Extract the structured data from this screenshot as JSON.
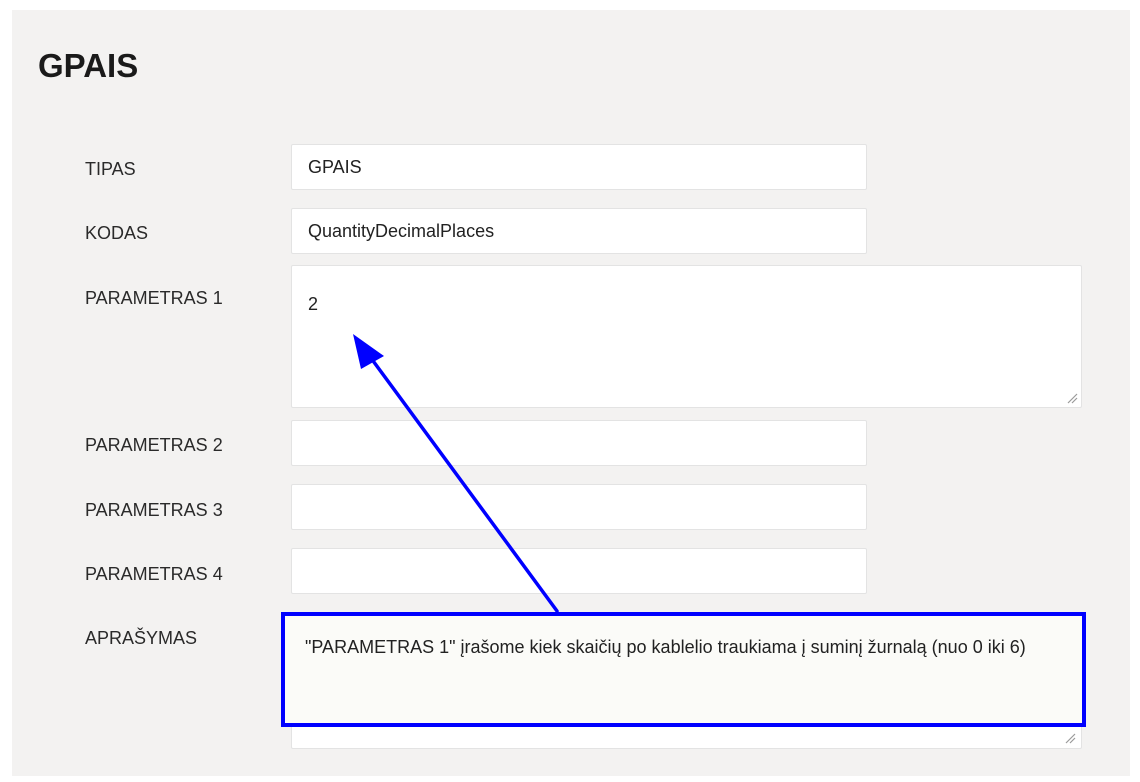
{
  "form": {
    "title": "GPAIS",
    "fields": [
      {
        "label": "TIPAS",
        "value": "GPAIS"
      },
      {
        "label": "KODAS",
        "value": "QuantityDecimalPlaces"
      },
      {
        "label": "PARAMETRAS 1",
        "value": "2"
      },
      {
        "label": "PARAMETRAS 2",
        "value": ""
      },
      {
        "label": "PARAMETRAS 3",
        "value": ""
      },
      {
        "label": "PARAMETRAS 4",
        "value": ""
      },
      {
        "label": "APRAŠYMAS",
        "value": ""
      }
    ]
  },
  "annotation": {
    "text": "\"PARAMETRAS 1\" įrašome kiek skaičių po kablelio traukiama į suminį žurnalą (nuo 0 iki 6)",
    "color": "#0000ff"
  }
}
